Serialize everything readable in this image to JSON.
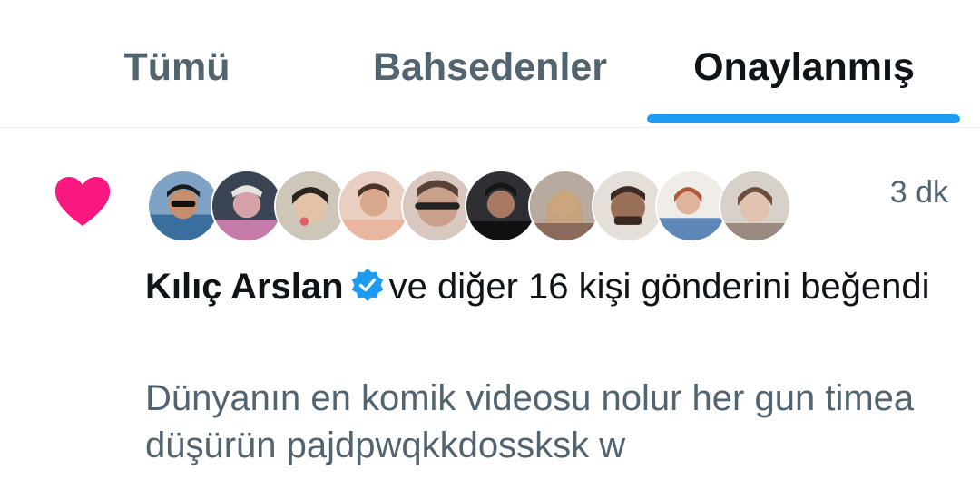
{
  "tabs": {
    "all": "Tümü",
    "mentions": "Bahsedenler",
    "verified": "Onaylanmış",
    "active": "verified"
  },
  "colors": {
    "accent": "#1d9bf0",
    "heart": "#f91880",
    "text_primary": "#0f1419",
    "text_secondary": "#536471"
  },
  "notification": {
    "icon": "heart-icon",
    "time": "3 dk",
    "avatar_count": 10,
    "user_name": "Kılıç Arslan",
    "verified_icon": "verified-badge-icon",
    "action_text": "ve diğer 16 kişi gönderini beğendi",
    "post_text": "Dünyanın en komik videosu nolur her gun timea düşürün pajdpwqkkdossksk w"
  }
}
